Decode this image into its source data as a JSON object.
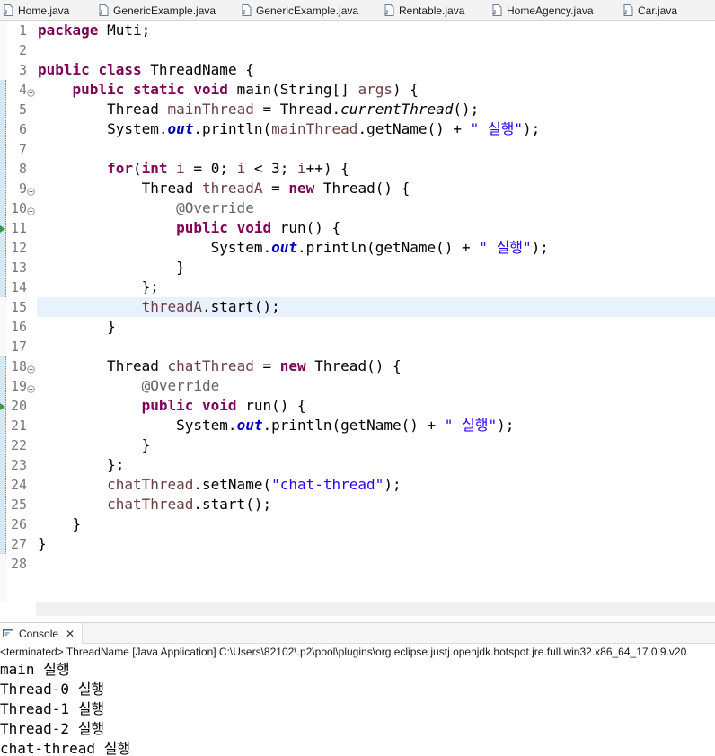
{
  "tabs": [
    {
      "label": "Home.java"
    },
    {
      "label": "GenericExample.java"
    },
    {
      "label": "GenericExample.java"
    },
    {
      "label": "Rentable.java"
    },
    {
      "label": "HomeAgency.java"
    },
    {
      "label": "Car.java"
    }
  ],
  "editor": {
    "line_numbers": [
      "1",
      "2",
      "3",
      "4",
      "5",
      "6",
      "7",
      "8",
      "9",
      "10",
      "11",
      "12",
      "13",
      "14",
      "15",
      "16",
      "17",
      "18",
      "19",
      "20",
      "21",
      "22",
      "23",
      "24",
      "25",
      "26",
      "27",
      "28"
    ],
    "current_line": "15",
    "code": {
      "l1": {
        "kw": "package",
        "rest": " Muti;"
      },
      "l3": {
        "kw1": "public",
        "kw2": "class",
        "rest": " ThreadName {"
      },
      "l4": {
        "kw1": "public",
        "kw2": "static",
        "kw3": "void",
        "mid": " main(String[] ",
        "var": "args",
        "rest": ") {"
      },
      "l5": {
        "a": "Thread ",
        "var": "mainThread",
        "b": " = Thread.",
        "st": "currentThread",
        "c": "();"
      },
      "l6": {
        "a": "System.",
        "fld": "out",
        "b": ".println(",
        "var": "mainThread",
        "c": ".getName() + ",
        "str": "\" 실행\"",
        "d": ");"
      },
      "l8": {
        "kw": "for",
        "a": "(",
        "kw2": "int",
        "b": " ",
        "var": "i",
        "c": " = 0; ",
        "var2": "i",
        "d": " < 3; ",
        "var3": "i",
        "e": "++) {"
      },
      "l9": {
        "a": "Thread ",
        "var": "threadA",
        "b": " = ",
        "kw": "new",
        "c": " Thread() {"
      },
      "l10": {
        "ann": "@Override"
      },
      "l11": {
        "kw1": "public",
        "kw2": "void",
        "rest": " run() {"
      },
      "l12": {
        "a": "System.",
        "fld": "out",
        "b": ".println(getName() + ",
        "str": "\" 실행\"",
        "c": ");"
      },
      "l13": {
        "a": "}"
      },
      "l14": {
        "a": "};"
      },
      "l15": {
        "var": "threadA",
        "a": ".start();"
      },
      "l16": {
        "a": "}"
      },
      "l18": {
        "a": "Thread ",
        "var": "chatThread",
        "b": " = ",
        "kw": "new",
        "c": " Thread() {"
      },
      "l19": {
        "ann": "@Override"
      },
      "l20": {
        "kw1": "public",
        "kw2": "void",
        "rest": " run() {"
      },
      "l21": {
        "a": "System.",
        "fld": "out",
        "b": ".println(getName() + ",
        "str": "\" 실행\"",
        "c": ");"
      },
      "l22": {
        "a": "}"
      },
      "l23": {
        "a": "};"
      },
      "l24": {
        "var": "chatThread",
        "a": ".setName(",
        "str": "\"chat-thread\"",
        "b": ");"
      },
      "l25": {
        "var": "chatThread",
        "a": ".start();"
      },
      "l26": {
        "a": "}"
      },
      "l27": {
        "a": "}"
      }
    }
  },
  "console": {
    "tab_label": "Console",
    "status": "<terminated> ThreadName [Java Application] C:\\Users\\82102\\.p2\\pool\\plugins\\org.eclipse.justj.openjdk.hotspot.jre.full.win32.x86_64_17.0.9.v20",
    "output": [
      "main 실행",
      "Thread-0 실행",
      "Thread-1 실행",
      "Thread-2 실행",
      "chat-thread 실행"
    ]
  },
  "colors": {
    "keyword": "#7f0055",
    "local_variable": "#6a3e3e",
    "static_field": "#0000c0",
    "string": "#2a00ff",
    "annotation": "#646464",
    "current_line": "#e8f2fe"
  },
  "icons": {
    "tab_file": "java-file-icon",
    "console": "console-icon",
    "fold": "collapse-fold-icon",
    "override": "override-marker-icon"
  }
}
